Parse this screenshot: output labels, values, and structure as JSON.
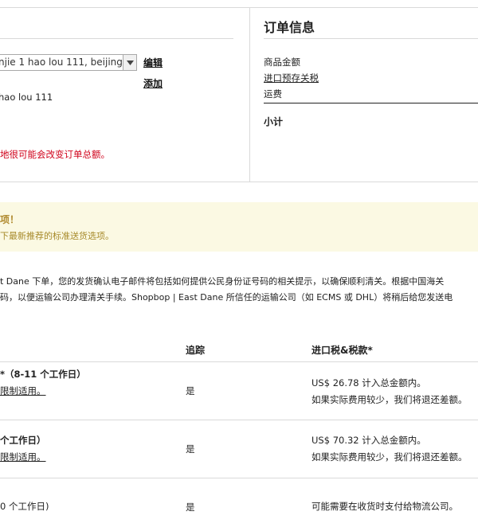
{
  "address": {
    "selected_value": "njie 1 hao lou 111, beijing",
    "edit_label": "编辑",
    "add_label": "添加",
    "line": "hao lou 111",
    "warning": "地很可能会改变订单总额。"
  },
  "summary": {
    "title": "订单信息",
    "rows": [
      "商品金额",
      "进口预存关税",
      "运费"
    ],
    "subtotal": "小计"
  },
  "notice": {
    "title": "项！",
    "text": "下最新推荐的标准送货选项。"
  },
  "info": {
    "line1": "t Dane 下单，您的发货确认电子邮件将包括如何提供公民身份证号码的相关提示，以确保顺利清关。根据中国海关",
    "line2": "码，以便运输公司办理清关手续。Shopbop | East Dane 所信任的运输公司（如 ECMS 或 DHL）将稍后给您发送电"
  },
  "table": {
    "headers": {
      "tracking": "追踪",
      "tax": "进口税&税款*"
    },
    "rows": [
      {
        "name": "*（8-11 个工作日）",
        "restriction": "限制适用。",
        "tracking": "是",
        "tax1": "US$ 26.78 计入总金额内。",
        "tax2": "如果实际费用较少，我们将退还差额。"
      },
      {
        "name": "个工作日）",
        "restriction": "限制适用。",
        "tracking": "是",
        "tax1": "US$ 70.32 计入总金额内。",
        "tax2": "如果实际费用较少，我们将退还差额。"
      },
      {
        "name": "0 个工作日)",
        "tracking": "是",
        "tax1": "可能需要在收货时支付给物流公司。"
      }
    ]
  },
  "colors": {
    "warn_bg": "#fbf9e3",
    "warn_text": "#b08a2e",
    "error_red": "#d0021b"
  },
  "icons": {
    "select_arrow": "chevron-down-icon"
  }
}
